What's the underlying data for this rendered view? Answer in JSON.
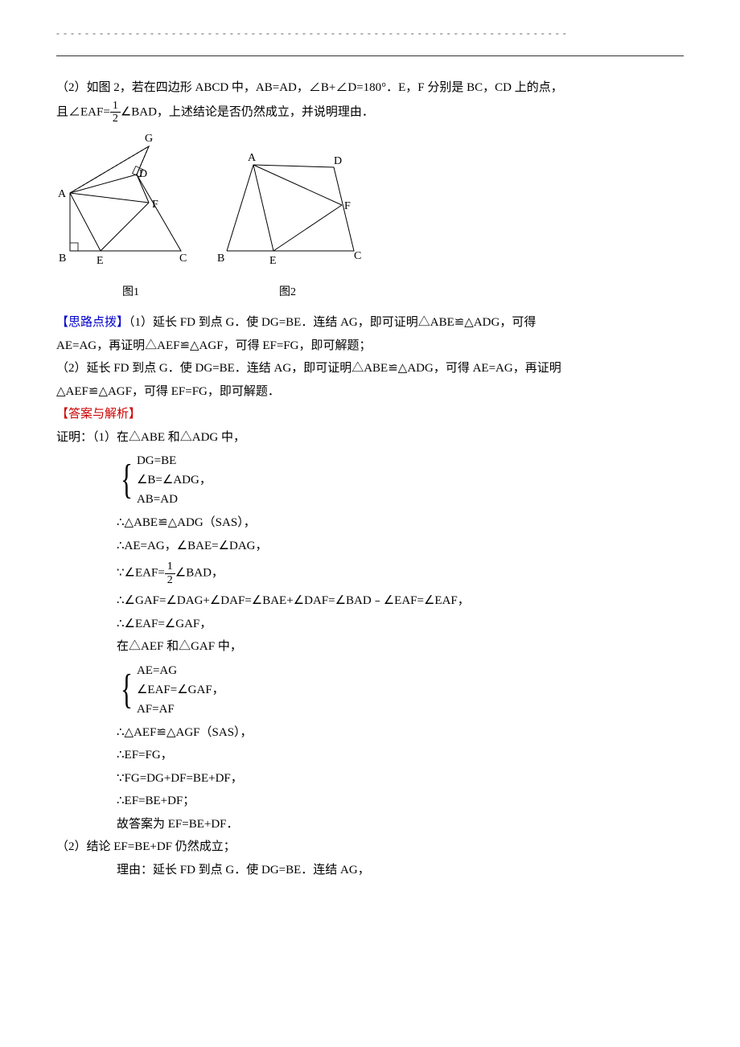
{
  "p1": "（2）如图 2，若在四边形 ABCD 中，AB=AD，∠B+∠D=180°．E，F 分别是 BC，CD 上的点，",
  "p2a": "且∠EAF=",
  "p2b": "∠BAD，上述结论是否仍然成立，并说明理由．",
  "frac1": {
    "num": "1",
    "den": "2"
  },
  "svg1": {
    "A": "A",
    "B": "B",
    "C": "C",
    "D": "D",
    "E": "E",
    "F": "F",
    "G": "G"
  },
  "svg2": {
    "A": "A",
    "B": "B",
    "C": "C",
    "D": "D",
    "E": "E",
    "F": "F"
  },
  "d1label": "图1",
  "d2label": "图2",
  "hint_label": "【思路点拨】",
  "hint_line1": "（1）延长 FD 到点 G．使 DG=BE．连结 AG，即可证明△ABE≌△ADG，可得",
  "hint_line2": "AE=AG，再证明△AEF≌△AGF，可得 EF=FG，即可解题；",
  "hint_line3": "（2）延长 FD 到点 G．使 DG=BE．连结 AG，即可证明△ABE≌△ADG，可得 AE=AG，再证明",
  "hint_line4": "△AEF≌△AGF，可得 EF=FG，即可解题．",
  "ans_label": "【答案与解析】",
  "proof_start": "证明：（1）在△ABE 和△ADG 中，",
  "b1": {
    "l1": "DG=BE",
    "l2": "∠B=∠ADG，",
    "l3": "AB=AD"
  },
  "p_l1": "∴△ABE≌△ADG（SAS），",
  "p_l2": "∴AE=AG，∠BAE=∠DAG，",
  "p_l3a": "∵∠EAF=",
  "p_l3b": "∠BAD，",
  "frac2": {
    "num": "1",
    "den": "2"
  },
  "p_l4": "∴∠GAF=∠DAG+∠DAF=∠BAE+∠DAF=∠BAD﹣∠EAF=∠EAF，",
  "p_l5": "∴∠EAF=∠GAF，",
  "p_l6": "在△AEF 和△GAF 中，",
  "b2": {
    "l1": "AE=AG",
    "l2": "∠EAF=∠GAF，",
    "l3": "AF=AF"
  },
  "p_l7": "∴△AEF≌△AGF（SAS），",
  "p_l8": "∴EF=FG，",
  "p_l9": "∵FG=DG+DF=BE+DF，",
  "p_l10": "∴EF=BE+DF；",
  "p_l11": "故答案为 EF=BE+DF．",
  "part2_l1": "（2）结论 EF=BE+DF 仍然成立；",
  "part2_l2": "理由：延长 FD 到点 G．使 DG=BE．连结 AG，"
}
